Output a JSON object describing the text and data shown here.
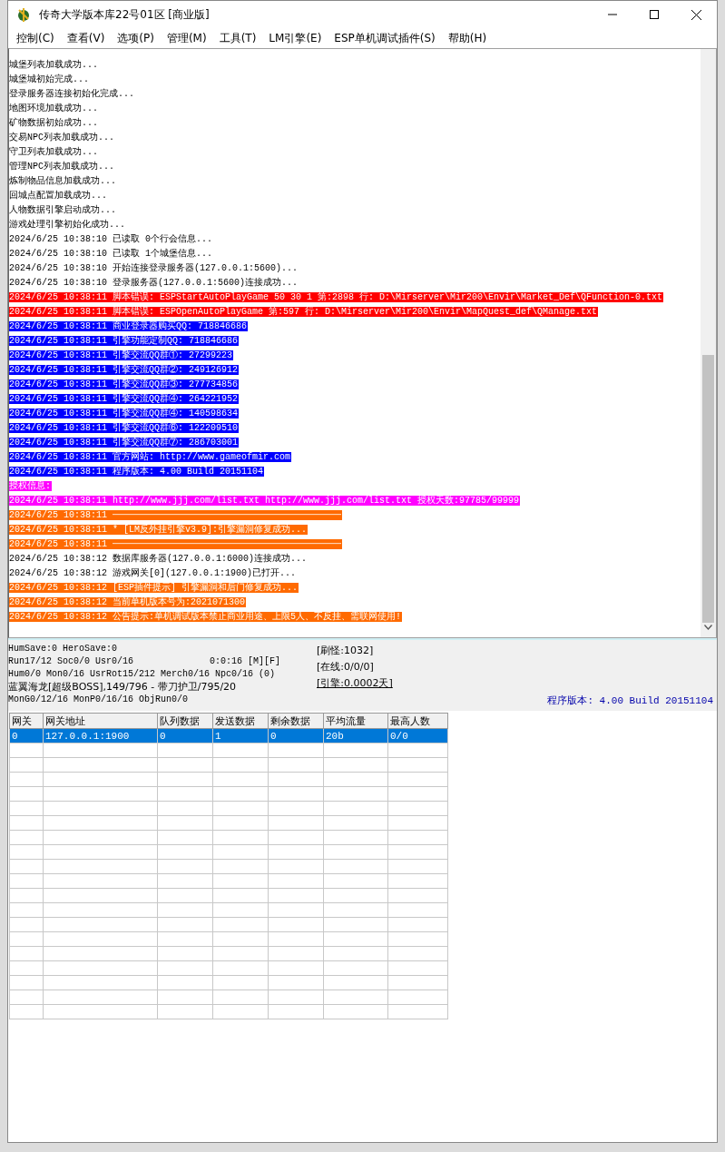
{
  "window": {
    "title": "传奇大学版本库22号01区 [商业版]"
  },
  "menu": [
    "控制(C)",
    "查看(V)",
    "选项(P)",
    "管理(M)",
    "工具(T)",
    "LM引擎(E)",
    "ESP单机调试插件(S)",
    "帮助(H)"
  ],
  "log": [
    {
      "kind": "normal",
      "text": "城堡列表加载成功..."
    },
    {
      "kind": "normal",
      "text": "城堡城初始完成..."
    },
    {
      "kind": "normal",
      "text": "登录服务器连接初始化完成..."
    },
    {
      "kind": "normal",
      "text": "地图环境加载成功..."
    },
    {
      "kind": "normal",
      "text": "矿物数据初始成功..."
    },
    {
      "kind": "normal",
      "text": "交易NPC列表加载成功..."
    },
    {
      "kind": "normal",
      "text": "守卫列表加载成功..."
    },
    {
      "kind": "normal",
      "text": "管理NPC列表加载成功..."
    },
    {
      "kind": "normal",
      "text": "炼制物品信息加载成功..."
    },
    {
      "kind": "normal",
      "text": "回城点配置加载成功..."
    },
    {
      "kind": "normal",
      "text": "人物数据引擎启动成功..."
    },
    {
      "kind": "normal",
      "text": "游戏处理引擎初始化成功..."
    },
    {
      "kind": "normal",
      "text": "2024/6/25 10:38:10 已读取 0个行会信息..."
    },
    {
      "kind": "normal",
      "text": "2024/6/25 10:38:10 已读取 1个城堡信息..."
    },
    {
      "kind": "normal",
      "text": "2024/6/25 10:38:10 开始连接登录服务器(127.0.0.1:5600)..."
    },
    {
      "kind": "normal",
      "text": "2024/6/25 10:38:10 登录服务器(127.0.0.1:5600)连接成功..."
    },
    {
      "kind": "error",
      "text": "2024/6/25 10:38:11 脚本错误: ESPStartAutoPlayGame 50 30 1 第:2898 行: D:\\Mirserver\\Mir200\\Envir\\Market_Def\\QFunction-0.txt"
    },
    {
      "kind": "error",
      "text": "2024/6/25 10:38:11 脚本错误: ESPOpenAutoPlayGame 第:597 行: D:\\Mirserver\\Mir200\\Envir\\MapQuest_def\\QManage.txt"
    },
    {
      "kind": "info",
      "text": "2024/6/25 10:38:11 商业登录器购买QQ: 718846686"
    },
    {
      "kind": "info",
      "text": "2024/6/25 10:38:11 引擎功能定制QQ: 718846686"
    },
    {
      "kind": "info",
      "text": "2024/6/25 10:38:11 引擎交流QQ群①: 27299223"
    },
    {
      "kind": "info",
      "text": "2024/6/25 10:38:11 引擎交流QQ群②: 249126912"
    },
    {
      "kind": "info",
      "text": "2024/6/25 10:38:11 引擎交流QQ群③: 277734856"
    },
    {
      "kind": "info",
      "text": "2024/6/25 10:38:11 引擎交流QQ群④: 264221952"
    },
    {
      "kind": "info",
      "text": "2024/6/25 10:38:11 引擎交流QQ群④: 140598634"
    },
    {
      "kind": "info",
      "text": "2024/6/25 10:38:11 引擎交流QQ群⑥: 122209510"
    },
    {
      "kind": "info",
      "text": "2024/6/25 10:38:11 引擎交流QQ群⑦: 286703001"
    },
    {
      "kind": "info",
      "text": "2024/6/25 10:38:11 官方网站: http://www.gameofmir.com"
    },
    {
      "kind": "info",
      "text": "2024/6/25 10:38:11 程序版本: 4.00 Build 20151104"
    },
    {
      "kind": "auth",
      "text": "授权信息:"
    },
    {
      "kind": "auth",
      "text": "2024/6/25 10:38:11 http://www.jjj.com/list.txt http://www.jjj.com/list.txt 授权天数:97785/99999"
    },
    {
      "kind": "notice",
      "text": "2024/6/25 10:38:11 ──────────────────────────────────────────"
    },
    {
      "kind": "notice",
      "text": "2024/6/25 10:38:11 * [LM反外挂引擎v3.9]:引擎漏洞修复成功..."
    },
    {
      "kind": "notice",
      "text": "2024/6/25 10:38:11 ──────────────────────────────────────────"
    },
    {
      "kind": "normal",
      "text": "2024/6/25 10:38:12 数据库服务器(127.0.0.1:6000)连接成功..."
    },
    {
      "kind": "normal",
      "text": "2024/6/25 10:38:12 游戏网关[0](127.0.0.1:1900)已打开..."
    },
    {
      "kind": "notice",
      "text": "2024/6/25 10:38:12 [ESP插件提示] 引擎漏洞和后门修复成功..."
    },
    {
      "kind": "notice",
      "text": "2024/6/25 10:38:12 当前单机版本号为:2021071300"
    },
    {
      "kind": "notice",
      "text": "2024/6/25 10:38:12 公告提示:单机调试版本禁止商业用途、上限5人、不反挂、需联网使用!"
    }
  ],
  "status": {
    "save": "HumSave:0 HeroSave:0",
    "run": "Run17/12 Soc0/0 Usr0/16",
    "time": "0:0:16 [M][F]",
    "counts": "Hum0/0 Mon0/16 UsrRot15/212 Merch0/16 Npc0/16 (0)",
    "boss": "蓝翼海龙[超级BOSS],149/796 - 带刀护卫/795/20",
    "objects": "MonG0/12/16 MonP0/16/16 ObjRun0/0",
    "refresh": "[刷怪:1032]",
    "online": "[在线:0/0/0]",
    "engine": "[引擎:0.0002天]",
    "version": "程序版本: 4.00 Build 20151104"
  },
  "table": {
    "columns": [
      "网关",
      "网关地址",
      "队列数据",
      "发送数据",
      "剩余数据",
      "平均流量",
      "最高人数"
    ],
    "rows": [
      {
        "selected": true,
        "cells": [
          "0",
          "127.0.0.1:1900",
          "0",
          "1",
          "0",
          "20b",
          "0/0"
        ]
      }
    ]
  }
}
